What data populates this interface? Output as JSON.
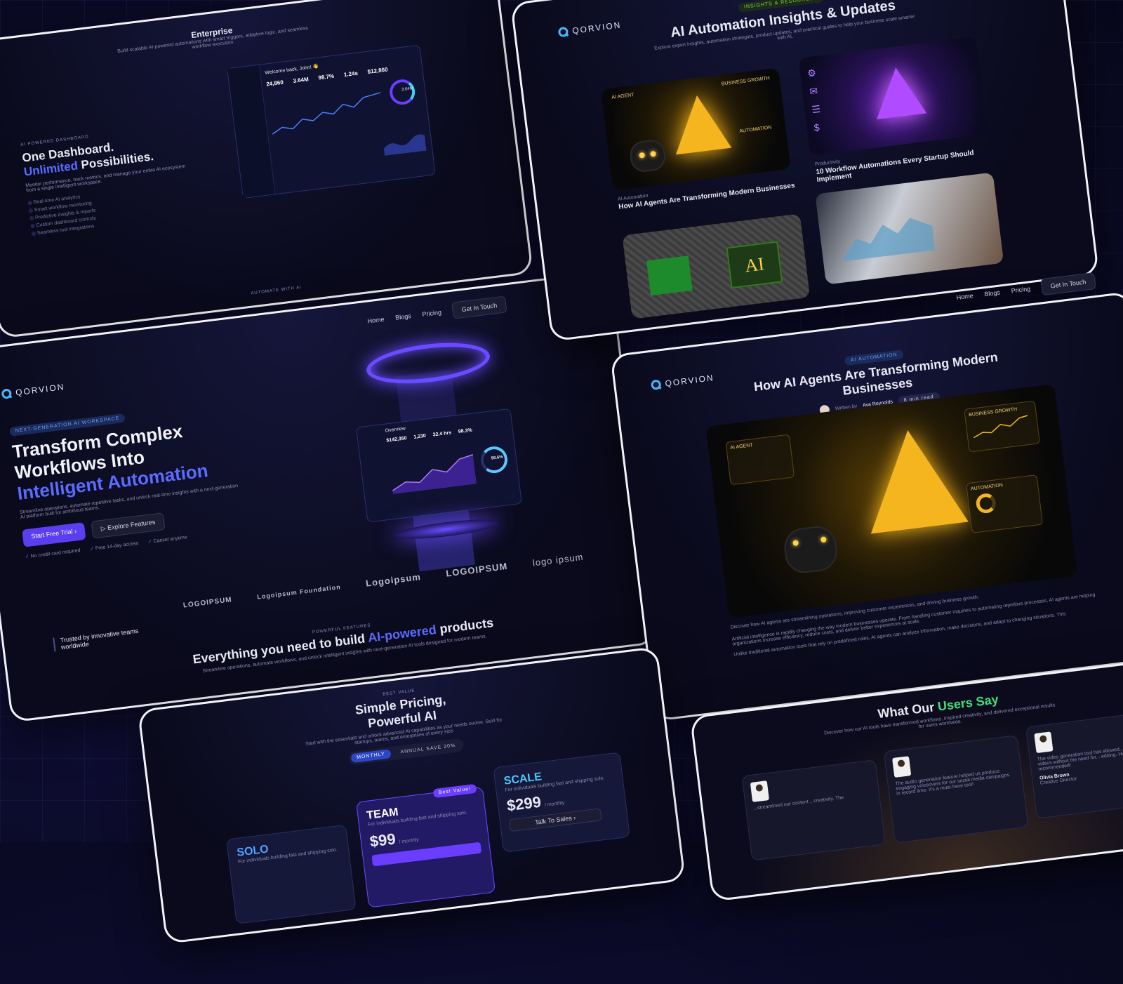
{
  "brand": {
    "name": "QORVION"
  },
  "nav": {
    "home": "Home",
    "blogs": "Blogs",
    "pricing": "Pricing",
    "cta": "Get In Touch"
  },
  "dashboard_card": {
    "top_text": "Enterprise",
    "top_sub": "Build scalable AI-powered automations with smart triggers, adaptive logic, and seamless workflow execution.",
    "eyebrow": "AI POWERED DASHBOARD",
    "title_line1": "One Dashboard.",
    "title_accent": "Unlimited",
    "title_line2": "Possibilities.",
    "desc": "Monitor performance, track metrics, and manage your entire AI ecosystem from a single intelligent workspace.",
    "features": [
      "Real-time AI analytics",
      "Smart workflow monitoring",
      "Predictive insights & reports",
      "Custom dashboard controls",
      "Seamless tool integrations"
    ],
    "welcome": "Welcome back, John! 👋",
    "stats": [
      "24,860",
      "3.64M",
      "98.7%",
      "1.24s",
      "$12,860"
    ],
    "ring": "3.64M",
    "footer_tag": "AUTOMATE WITH AI"
  },
  "hero_card": {
    "pill": "NEXT-GENERATION AI WORKSPACE",
    "title_line1": "Transform Complex",
    "title_line2": "Workflows Into",
    "title_accent": "Intelligent Automation",
    "desc": "Streamline operations, automate repetitive tasks, and unlock real-time insights with a next-generation AI platform built for ambitious teams.",
    "cta_primary": "Start Free Trial",
    "cta_secondary": "Explore Features",
    "checks": [
      "No credit card required",
      "Free 14-day access",
      "Cancel anytime"
    ],
    "trusted": "Trusted by innovative teams worldwide",
    "logos": [
      "LOGOIPSUM",
      "Logoipsum Foundation",
      "Logoipsum",
      "LOGOIPSUM",
      "logo ipsum"
    ],
    "features_tag": "POWERFUL FEATURES",
    "features_title": "Everything you need to build",
    "features_accent": "AI-powered",
    "features_tail": "products",
    "features_desc": "Streamline operations, automate workflows, and unlock intelligent insights with next-generation AI tools designed for modern teams.",
    "dash_overview": "Overview",
    "dash_stats": [
      "$142,350",
      "1,230",
      "32.4 hrs",
      "98.3%"
    ],
    "dash_ring": "98.6%"
  },
  "blog_card": {
    "pill": "INSIGHTS & RESOURCES",
    "title": "AI Automation Insights & Updates",
    "desc": "Explore expert insights, automation strategies, product updates, and practical guides to help your business scale smarter with AI.",
    "posts": [
      {
        "category": "AI Automation",
        "title": "How AI Agents Are Transforming Modern Businesses"
      },
      {
        "category": "Productivity",
        "title": "10 Workflow Automations Every Startup Should Implement"
      }
    ],
    "image_labels": {
      "agent": "AI AGENT",
      "growth": "BUSINESS GROWTH",
      "automation": "AUTOMATION",
      "chip": "AI"
    }
  },
  "article_card": {
    "pill": "AI AUTOMATION",
    "title": "How AI Agents Are Transforming Modern Businesses",
    "author_label": "Written by",
    "author": "Ava Reynolds",
    "read_time": "8 min read",
    "image_labels": {
      "agent": "AI AGENT",
      "growth": "BUSINESS GROWTH",
      "automation": "AUTOMATION"
    },
    "p1": "Discover how AI agents are streamlining operations, improving customer experiences, and driving business growth.",
    "p2": "Artificial intelligence is rapidly changing the way modern businesses operate. From handling customer inquiries to automating repetitive processes, AI agents are helping organizations increase efficiency, reduce costs, and deliver better experiences at scale.",
    "p3": "Unlike traditional automation tools that rely on predefined rules, AI agents can analyze information, make decisions, and adapt to changing situations. This"
  },
  "pricing_card": {
    "tag": "BEST VALUE",
    "title_line1": "Simple Pricing,",
    "title_line2": "Powerful AI",
    "desc": "Start with the essentials and unlock advanced AI capabilities as your needs evolve. Built for startups, teams, and enterprises of every size.",
    "toggle_monthly": "MONTHLY",
    "toggle_annual": "ANNUAL",
    "toggle_save": "SAVE 20%",
    "plans": [
      {
        "name": "SOLO",
        "desc": "For individuals building fast and shipping solo.",
        "price": "",
        "period": "",
        "badge": "",
        "button": ""
      },
      {
        "name": "TEAM",
        "desc": "For individuals building fast and shipping solo.",
        "price": "$99",
        "period": "/ monthly",
        "badge": "Best Value!",
        "button": ""
      },
      {
        "name": "SCALE",
        "desc": "For individuals building fast and shipping solo.",
        "price": "$299",
        "period": "/ monthly",
        "badge": "",
        "button": "Talk To Sales"
      }
    ]
  },
  "testimonials_card": {
    "title": "What Our",
    "title_accent": "Users Say",
    "desc": "Discover how our AI tools have transformed workflows, inspired creativity, and delivered exceptional results for users worldwide.",
    "items": [
      {
        "quote": "...streamlined our content ...creativity. The",
        "name": "",
        "role": ""
      },
      {
        "quote": "The audio generation feature helped us produce engaging voiceovers for our social media campaigns in record time. It's a must-have tool!",
        "name": "",
        "role": ""
      },
      {
        "quote": "The video generation tool has allowed... professional videos without the need for... editing. Highly recommended!",
        "name": "Olivia Brown",
        "role": "Creative Director"
      }
    ]
  },
  "colors": {
    "accent": "#5b6bff",
    "primary_button": "#5a3ef0",
    "green": "#3fe07a",
    "gold": "#f4b51f"
  }
}
